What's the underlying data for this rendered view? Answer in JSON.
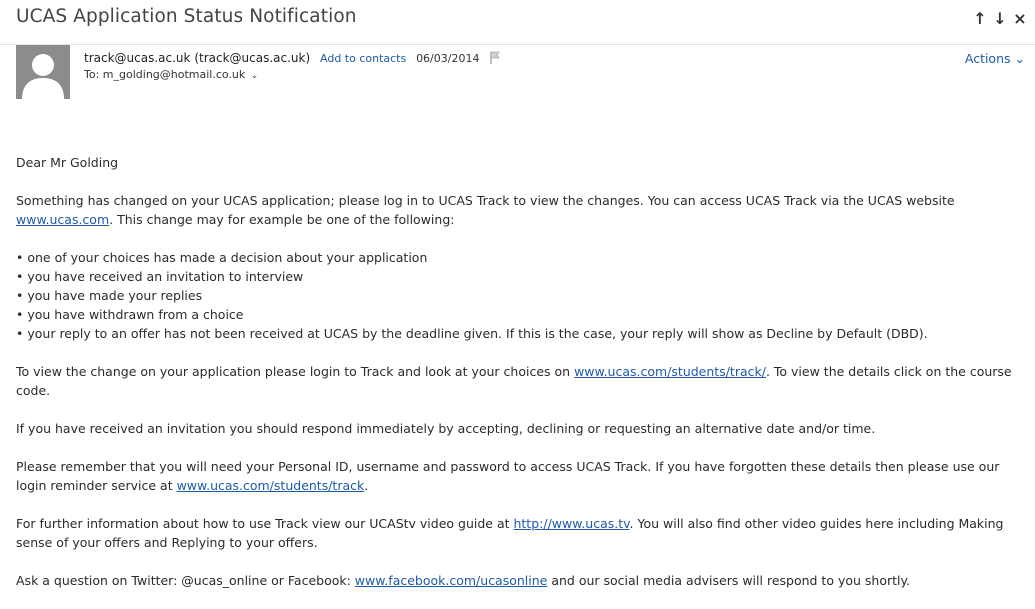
{
  "header": {
    "subject": "UCAS Application Status Notification",
    "prev_label": "↑",
    "next_label": "↓",
    "close_label": "×"
  },
  "message": {
    "sender_email": "track@ucas.ac.uk",
    "sender_display": "(track@ucas.ac.uk)",
    "add_contact": "Add to contacts",
    "date": "06/03/2014",
    "to_label": "To:",
    "to_address": "m_golding@hotmail.co.uk",
    "to_caret": "⌄",
    "actions_label": "Actions",
    "actions_caret": "⌄"
  },
  "body": {
    "greeting": "Dear Mr Golding",
    "p1_text": "Something has changed on your UCAS application; please log in to UCAS Track to view the changes. You can access UCAS Track via the UCAS website ",
    "p1_link": "www.ucas.com",
    "p1_after": ". This change may for example be one of the following:",
    "bullets": [
      "one of your choices has made a decision about your application",
      "you have received an invitation to interview",
      "you have made your replies",
      "you have withdrawn from a choice",
      "your reply to an offer has not been received at UCAS by the deadline given. If this is the case, your reply will show as Decline by Default (DBD)."
    ],
    "p2_text": "To view the change on your application please login to Track and look at your choices on ",
    "p2_link": "www.ucas.com/students/track/",
    "p2_after": ". To view the details click on the course code.",
    "p3_text": "If you have received an invitation you should respond immediately by accepting, declining or requesting an alternative date and/or time.",
    "p4_text": "Please remember that you will need your Personal ID, username and password to access UCAS Track. If you have forgotten these details then please use our login reminder service at ",
    "p4_link": "www.ucas.com/students/track",
    "p4_after": ".",
    "p5_text": "For further information about how to use Track view our UCAStv video guide at ",
    "p5_link": "http://www.ucas.tv",
    "p5_after": ". You will also find other video guides here including Making sense of your offers and Replying to your offers.",
    "p6_text": "Ask a question on Twitter: @ucas_online or Facebook: ",
    "p6_link": "www.facebook.com/ucasonline",
    "p6_after": " and our social media advisers will respond to you shortly."
  }
}
